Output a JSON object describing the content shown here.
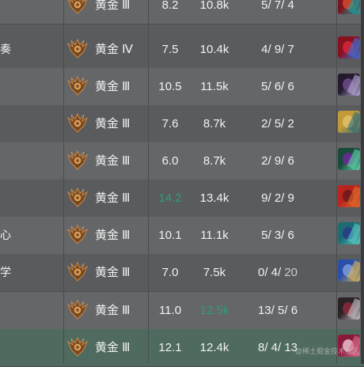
{
  "rows": [
    {
      "name": "",
      "rank": "黄金 Ⅲ",
      "avg": "8.2",
      "gold": "10.8k",
      "kda": [
        "5",
        "7",
        "4"
      ],
      "win": false,
      "avg_green": false,
      "gold_green": false,
      "colors": [
        "#7b1522",
        "#1ca3a0",
        "#d54a2f"
      ]
    },
    {
      "name": "奏",
      "rank": "黄金 Ⅳ",
      "avg": "7.5",
      "gold": "10.4k",
      "kda": [
        "4",
        "9",
        "7"
      ],
      "win": false,
      "avg_green": false,
      "gold_green": false,
      "colors": [
        "#8a1020",
        "#3a6fd8",
        "#cf2a3c"
      ]
    },
    {
      "name": "",
      "rank": "黄金 Ⅲ",
      "avg": "10.5",
      "gold": "11.5k",
      "kda": [
        "5",
        "6",
        "6"
      ],
      "win": false,
      "avg_green": false,
      "gold_green": false,
      "colors": [
        "#231a2e",
        "#b9a9d8",
        "#6d4c88"
      ]
    },
    {
      "name": "",
      "rank": "黄金 Ⅲ",
      "avg": "7.6",
      "gold": "8.7k",
      "kda": [
        "2",
        "5",
        "2"
      ],
      "win": false,
      "avg_green": false,
      "gold_green": false,
      "colors": [
        "#c39a3a",
        "#2e6a7a",
        "#e0c26a"
      ]
    },
    {
      "name": "",
      "rank": "黄金 Ⅲ",
      "avg": "6.0",
      "gold": "8.7k",
      "kda": [
        "2",
        "9",
        "6"
      ],
      "win": false,
      "avg_green": false,
      "gold_green": false,
      "colors": [
        "#1a4a3a",
        "#5fd0a8",
        "#6e2a9a"
      ]
    },
    {
      "name": "",
      "rank": "黄金 Ⅲ",
      "avg": "14.2",
      "gold": "13.4k",
      "kda": [
        "9",
        "2",
        "9"
      ],
      "win": false,
      "avg_green": true,
      "gold_green": false,
      "colors": [
        "#b8241e",
        "#e06a2a",
        "#6a1a1a"
      ]
    },
    {
      "name": "心",
      "rank": "黄金 Ⅲ",
      "avg": "10.1",
      "gold": "11.1k",
      "kda": [
        "5",
        "3",
        "6"
      ],
      "win": false,
      "avg_green": false,
      "gold_green": false,
      "colors": [
        "#1c6a72",
        "#58c8c0",
        "#2a3a8a"
      ]
    },
    {
      "name": "学",
      "rank": "黄金 Ⅲ",
      "avg": "7.0",
      "gold": "7.5k",
      "kda": [
        "0",
        "4",
        "20"
      ],
      "win": false,
      "avg_green": false,
      "gold_green": false,
      "colors": [
        "#2a4fa8",
        "#d8b45a",
        "#7a9ad8"
      ]
    },
    {
      "name": "",
      "rank": "黄金 Ⅲ",
      "avg": "11.0",
      "gold": "12.5k",
      "kda": [
        "13",
        "5",
        "6"
      ],
      "win": false,
      "avg_green": false,
      "gold_green": true,
      "colors": [
        "#2a2226",
        "#c9c0c8",
        "#8a2a3a"
      ]
    },
    {
      "name": "",
      "rank": "黄金 Ⅲ",
      "avg": "12.1",
      "gold": "12.4k",
      "kda": [
        "8",
        "4",
        "13"
      ],
      "win": true,
      "avg_green": false,
      "gold_green": false,
      "colors": [
        "#8a1a3a",
        "#d86a8a",
        "#e8c0d0"
      ]
    }
  ],
  "watermark": "@稀土掘金技术社区",
  "icon": "gold-rank-emblem-icon"
}
